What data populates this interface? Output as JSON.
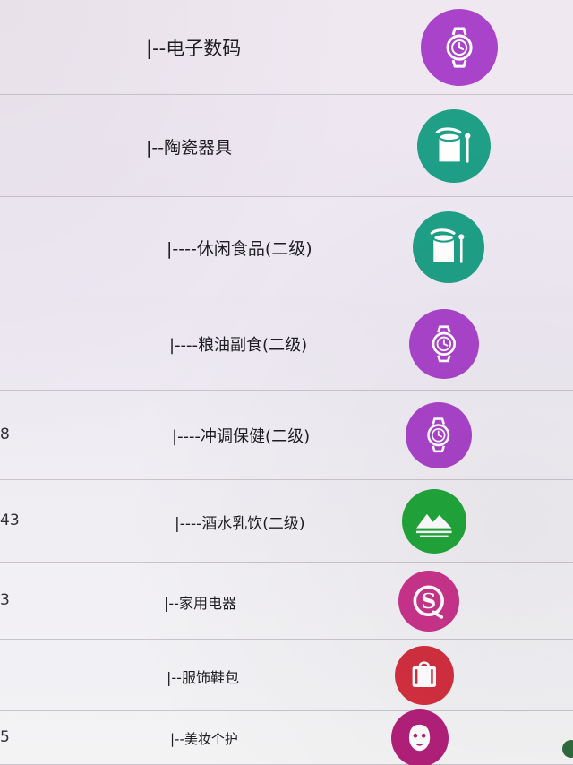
{
  "category_list": {
    "rows": [
      {
        "id": "",
        "name": "|--电子数码",
        "icon": "watch-icon",
        "color": "#a943c9"
      },
      {
        "id": "",
        "name": "|--陶瓷器具",
        "icon": "cup-icon",
        "color": "#1e9f86"
      },
      {
        "id": "",
        "name": "|----休闲食品(二级)",
        "icon": "cup-icon",
        "color": "#1e9f86"
      },
      {
        "id": "",
        "name": "|----粮油副食(二级)",
        "icon": "watch-icon",
        "color": "#a943c9"
      },
      {
        "id": "8",
        "name": "|----冲调保健(二级)",
        "icon": "watch-icon",
        "color": "#a943c9"
      },
      {
        "id": "43",
        "name": "|----酒水乳饮(二级)",
        "icon": "mountain-icon",
        "color": "#20a53a"
      },
      {
        "id": "3",
        "name": "|--家用电器",
        "icon": "s-logo-icon",
        "color": "#c8338a"
      },
      {
        "id": "",
        "name": "|--服饰鞋包",
        "icon": "bag-icon",
        "color": "#d22f3f"
      },
      {
        "id": "5",
        "name": "|--美妆个护",
        "icon": "face-mask-icon",
        "color": "#b1207a"
      }
    ]
  }
}
